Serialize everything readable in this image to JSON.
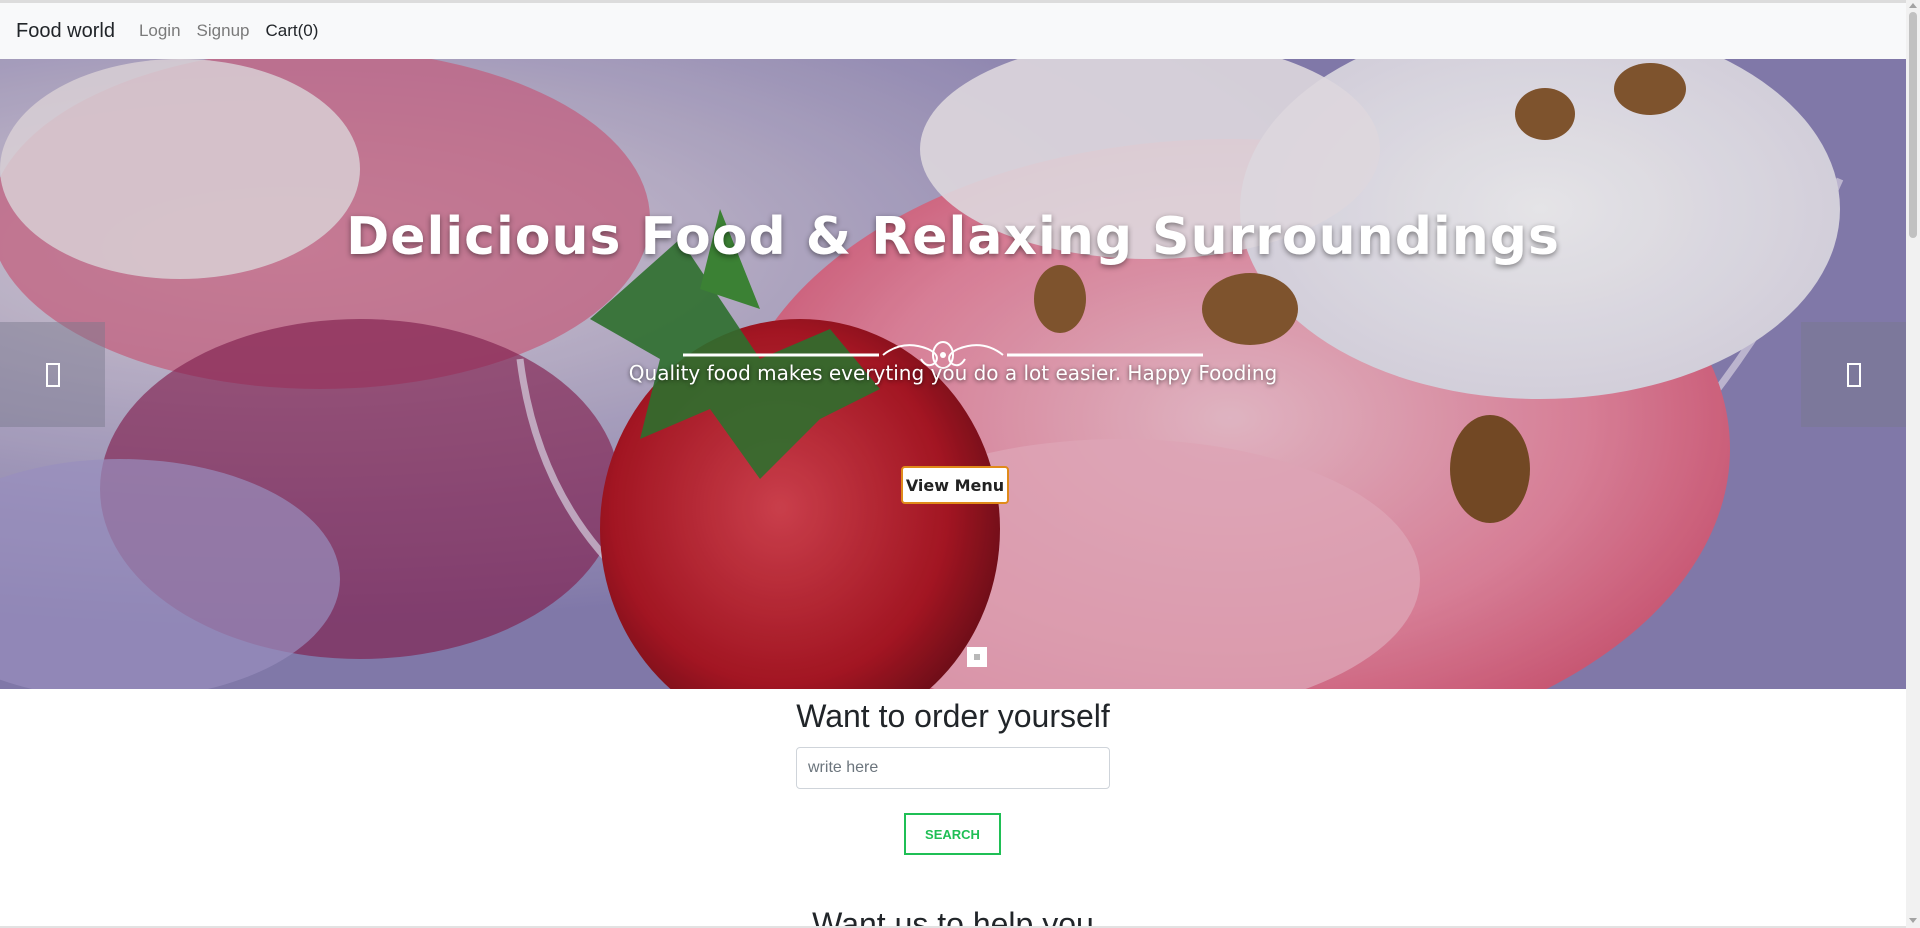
{
  "navbar": {
    "brand": "Food world",
    "links": [
      {
        "label": "Login"
      },
      {
        "label": "Signup"
      },
      {
        "label": "Cart(0)"
      }
    ]
  },
  "hero": {
    "title": "Delicious Food & Relaxing Surroundings",
    "subtitle": "Quality food makes everyting you do a lot easier. Happy Fooding",
    "button_label": "View Menu",
    "prev_icon": "chevron-left-icon",
    "next_icon": "chevron-right-icon",
    "slide_count": 1,
    "active_slide": 1
  },
  "order": {
    "heading": "Want to order yourself",
    "search_placeholder": "write here",
    "search_value": "",
    "search_button": "SEARCH"
  },
  "help": {
    "heading": "Want us to help you"
  },
  "colors": {
    "navbar_bg": "#f8f9fa",
    "view_menu_border": "#e08a1a",
    "search_accent": "#1fbf55"
  }
}
